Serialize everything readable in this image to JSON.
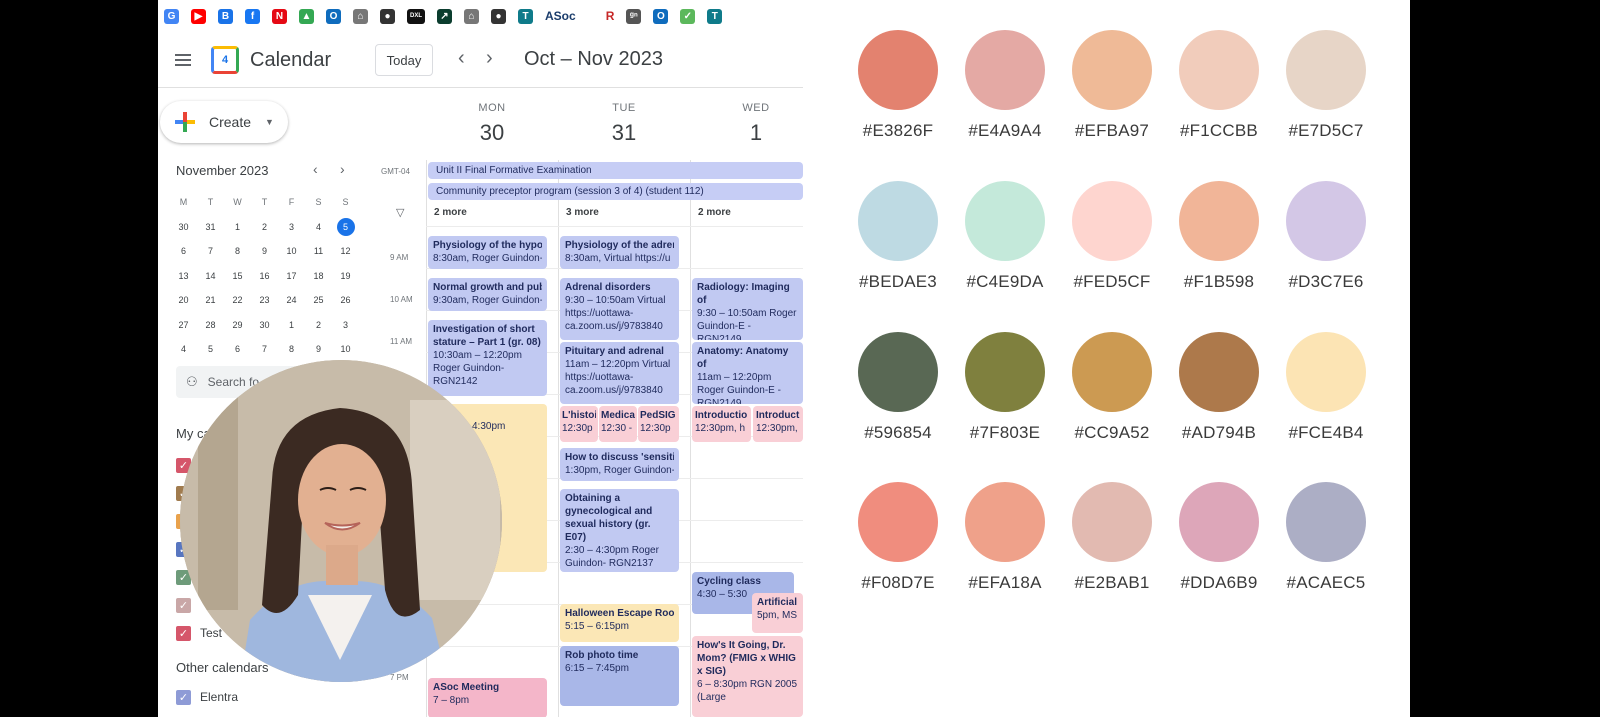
{
  "bookmarks": [
    {
      "icon": "google-icon",
      "glyph": "G",
      "color": "#4285F4"
    },
    {
      "icon": "youtube-icon",
      "glyph": "▶",
      "color": "#FF0000"
    },
    {
      "icon": "doc-icon",
      "glyph": "B",
      "color": "#1A73E8"
    },
    {
      "icon": "facebook-icon",
      "glyph": "f",
      "color": "#1877F2"
    },
    {
      "icon": "netflix-icon",
      "glyph": "N",
      "color": "#E50914"
    },
    {
      "icon": "drive-icon",
      "glyph": "▲",
      "color": "#34A853"
    },
    {
      "icon": "outlook-icon",
      "glyph": "O",
      "color": "#0F6CBD"
    },
    {
      "icon": "bank-icon",
      "glyph": "⌂",
      "color": "#777777"
    },
    {
      "icon": "globe-icon",
      "glyph": "●",
      "color": "#333333"
    },
    {
      "icon": "dxl-icon",
      "glyph": "DXL",
      "color": "#111111"
    },
    {
      "icon": "chart-icon",
      "glyph": "↗",
      "color": "#0B3D2E"
    },
    {
      "icon": "bank-icon-2",
      "glyph": "⌂",
      "color": "#777777"
    },
    {
      "icon": "globe-icon-2",
      "glyph": "●",
      "color": "#333333"
    },
    {
      "icon": "teams-icon",
      "glyph": "T",
      "color": "#0F7B8A"
    },
    {
      "icon": "text-icon",
      "glyph": "ᵍⁿ",
      "color": "#555555"
    },
    {
      "icon": "outlook-icon-2",
      "glyph": "O",
      "color": "#0F6CBD"
    },
    {
      "icon": "shield-icon",
      "glyph": "✓",
      "color": "#5CB85C"
    },
    {
      "icon": "teams-icon-2",
      "glyph": "T",
      "color": "#0F7B8A"
    }
  ],
  "bookmark_text": "ASoc",
  "bookmark_r": "R",
  "header": {
    "app_title": "Calendar",
    "logo_day": "4",
    "today_label": "Today",
    "range_label": "Oct – Nov 2023"
  },
  "sidebar": {
    "create_label": "Create",
    "mini_title": "November 2023",
    "dow": [
      "M",
      "T",
      "W",
      "T",
      "F",
      "S",
      "S"
    ],
    "weeks": [
      [
        "30",
        "31",
        "1",
        "2",
        "3",
        "4",
        "5"
      ],
      [
        "6",
        "7",
        "8",
        "9",
        "10",
        "11",
        "12"
      ],
      [
        "13",
        "14",
        "15",
        "16",
        "17",
        "18",
        "19"
      ],
      [
        "20",
        "21",
        "22",
        "23",
        "24",
        "25",
        "26"
      ],
      [
        "27",
        "28",
        "29",
        "30",
        "1",
        "2",
        "3"
      ],
      [
        "4",
        "5",
        "6",
        "7",
        "8",
        "9",
        "10"
      ]
    ],
    "today_value": "5",
    "search_label": "Search fo",
    "my_calendars_label": "My ca",
    "calendars": [
      {
        "label": "",
        "color": "#D5566A"
      },
      {
        "label": "",
        "color": "#A07B4E"
      },
      {
        "label": "",
        "color": "#E9A24C"
      },
      {
        "label": "",
        "color": "#5876C0"
      },
      {
        "label": "",
        "color": "#6E9B7A"
      },
      {
        "label": "",
        "color": "#C9A7A7"
      },
      {
        "label": "Test",
        "color": "#D5566A"
      }
    ],
    "other_calendars_label": "Other calendars",
    "other_items": [
      {
        "label": "Elentra",
        "color": "#8E9BD6"
      }
    ]
  },
  "grid": {
    "timezone": "GMT-04",
    "days": [
      {
        "dow": "MON",
        "num": "30"
      },
      {
        "dow": "TUE",
        "num": "31"
      },
      {
        "dow": "WED",
        "num": "1"
      }
    ],
    "allday": [
      "Unit II Final Formative Examination",
      "Community preceptor program (session 3 of 4) (student 112)"
    ],
    "more": [
      "2 more",
      "3 more",
      "2 more"
    ],
    "times": [
      "9 AM",
      "10 AM",
      "11 AM",
      "7 PM"
    ],
    "events": {
      "mon": [
        {
          "title": "Physiology of the hypot",
          "detail": "8:30am, Roger Guindon-"
        },
        {
          "title": "Normal growth and pub",
          "detail": "9:30am, Roger Guindon-"
        },
        {
          "title": "Investigation of short stature – Part 1 (gr. 08)",
          "detail": "10:30am – 12:20pm Roger Guindon- RGN2142"
        },
        {
          "title": "",
          "detail": "4:30pm"
        },
        {
          "title": "ASoc Meeting",
          "detail": "7 – 8pm"
        }
      ],
      "tue": [
        {
          "title": "Physiology of the adren",
          "detail": "8:30am, Virtual https://u"
        },
        {
          "title": "Adrenal disorders",
          "detail": "9:30 – 10:50am Virtual https://uottawa-ca.zoom.us/j/9783840"
        },
        {
          "title": "Pituitary and adrenal",
          "detail": "11am – 12:20pm Virtual https://uottawa-ca.zoom.us/j/9783840"
        },
        {
          "title": "L'histoi",
          "detail": "12:30p"
        },
        {
          "title": "Medica",
          "detail": "12:30 -"
        },
        {
          "title": "PedSIG",
          "detail": "12:30p"
        },
        {
          "title": "How to discuss 'sensitiv",
          "detail": "1:30pm, Roger Guindon-"
        },
        {
          "title": "Obtaining a gynecological and sexual history (gr. E07)",
          "detail": "2:30 – 4:30pm Roger Guindon- RGN2137"
        },
        {
          "title": "Halloween Escape Room",
          "detail": "5:15 – 6:15pm"
        },
        {
          "title": "Rob photo time",
          "detail": "6:15 – 7:45pm"
        }
      ],
      "wed": [
        {
          "title": "Radiology: Imaging of",
          "detail": "9:30 – 10:50am Roger Guindon-E - RGN2149"
        },
        {
          "title": "Anatomy: Anatomy of",
          "detail": "11am – 12:20pm Roger Guindon-E - RGN2149"
        },
        {
          "title": "Introductio",
          "detail": "12:30pm, h"
        },
        {
          "title": "Introducti",
          "detail": "12:30pm,"
        },
        {
          "title": "Cycling class",
          "detail": "4:30 – 5:30"
        },
        {
          "title": "Artificial",
          "detail": "5pm, MS"
        },
        {
          "title": "How's It Going, Dr. Mom? (FMIG x WHIG x SIG)",
          "detail": "6 – 8:30pm RGN 2005 (Large"
        }
      ]
    }
  },
  "palette": [
    [
      "#E3826F",
      "#E4A9A4",
      "#EFBA97",
      "#F1CCBB",
      "#E7D5C7"
    ],
    [
      "#BEDAE3",
      "#C4E9DA",
      "#FED5CF",
      "#F1B598",
      "#D3C7E6"
    ],
    [
      "#596854",
      "#7F803E",
      "#CC9A52",
      "#AD794B",
      "#FCE4B4"
    ],
    [
      "#F08D7E",
      "#EFA18A",
      "#E2BAB1",
      "#DDA6B9",
      "#ACAEC5"
    ]
  ]
}
